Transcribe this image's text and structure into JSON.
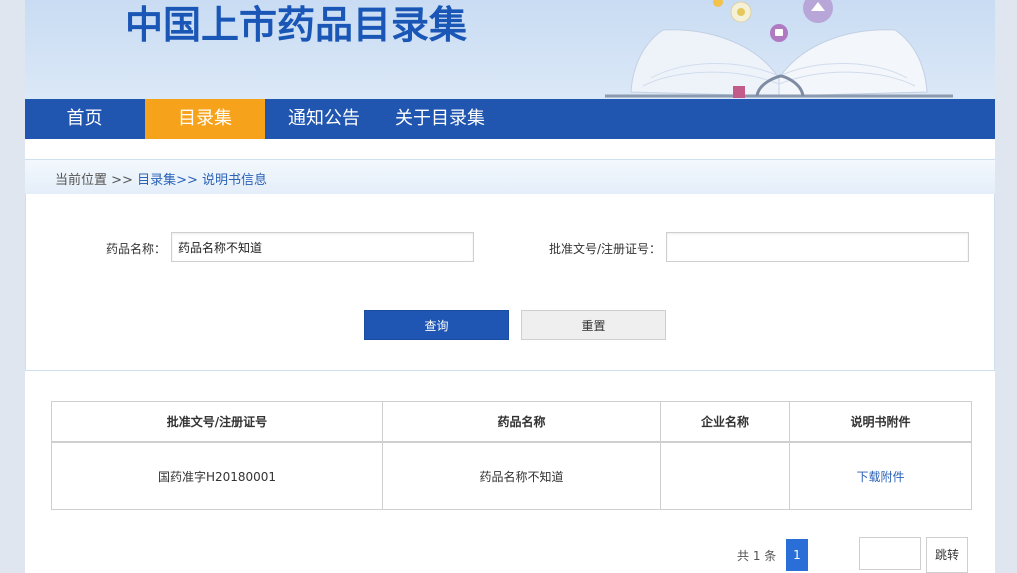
{
  "banner": {
    "title": "中国上市药品目录集"
  },
  "nav": {
    "items": [
      {
        "label": "首页"
      },
      {
        "label": "目录集"
      },
      {
        "label": "通知公告"
      },
      {
        "label": "关于目录集"
      }
    ],
    "active_index": 1
  },
  "breadcrumb": {
    "prefix": "当前位置 >> ",
    "level1": "目录集",
    "sep": ">> ",
    "level2": "说明书信息"
  },
  "search": {
    "drug_name_label": "药品名称：",
    "drug_name_value": "药品名称不知道",
    "approval_label": "批准文号/注册证号：",
    "approval_value": "",
    "query_button": "查询",
    "reset_button": "重置"
  },
  "table": {
    "headers": [
      "批准文号/注册证号",
      "药品名称",
      "企业名称",
      "说明书附件"
    ],
    "rows": [
      {
        "approval_no": "国药准字H20180001",
        "drug_name": "药品名称不知道",
        "company": "",
        "attachment": "下载附件"
      }
    ]
  },
  "pagination": {
    "total_text": "共 1 条",
    "current_page": "1",
    "jump_label": "跳转"
  },
  "colors": {
    "nav_bg": "#2055b0",
    "nav_active": "#f7a21b",
    "primary_button": "#1f55b3",
    "link": "#2a62b7"
  }
}
